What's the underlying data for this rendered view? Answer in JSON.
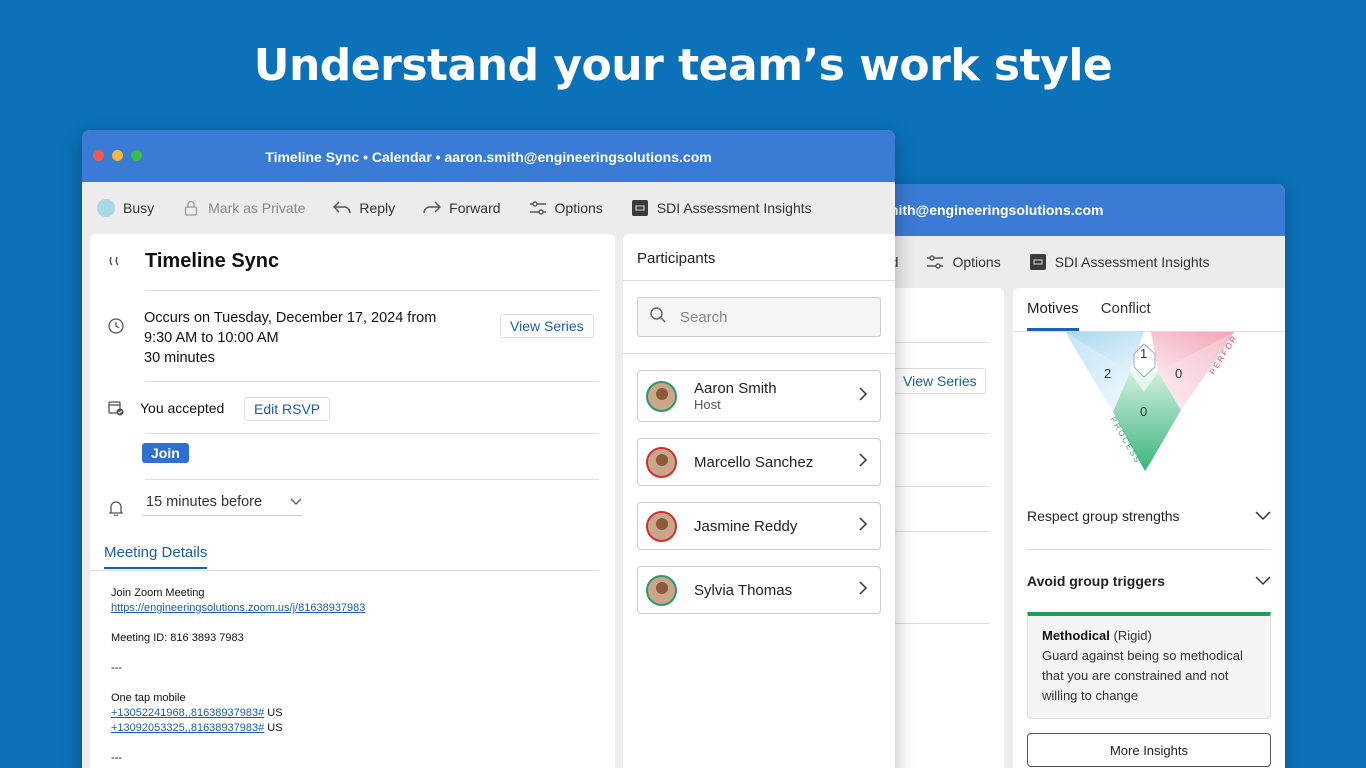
{
  "hero": "Understand your team’s work style",
  "colors": {
    "background": "#0b72b9",
    "titlebar": "#3a7bd5",
    "accent": "#1a5dab",
    "insight_border": "#1aa05a"
  },
  "back_window": {
    "title": "mith@engineeringsolutions.com",
    "toolbar": {
      "options": "Options",
      "sdi": "SDI Assessment Insights",
      "partial": "rd"
    },
    "view_series": "View Series",
    "tabs": [
      "Motives",
      "Conflict"
    ],
    "triangle": {
      "top": "1",
      "left": "2",
      "right": "0",
      "center": "0",
      "label_right": "PERFOR",
      "label_left": "PROCESS"
    },
    "respect": "Respect group strengths",
    "avoid": "Avoid group triggers",
    "insight": {
      "title": "Methodical",
      "qualifier": "(Rigid)",
      "text": "Guard against being so methodical that you are constrained and not willing to change"
    },
    "more": "More Insights"
  },
  "front_window": {
    "title": "Timeline Sync  •  Calendar  •  aaron.smith@engineeringsolutions.com",
    "toolbar": {
      "busy": "Busy",
      "private": "Mark as Private",
      "reply": "Reply",
      "forward": "Forward",
      "options": "Options",
      "sdi": "SDI Assessment Insights"
    },
    "subject": "Timeline Sync",
    "occurs_line1": "Occurs on Tuesday, December 17, 2024 from",
    "occurs_line2": "9:30 AM to 10:00 AM",
    "occurs_line3": "30 minutes",
    "view_series": "View Series",
    "accepted": "You accepted",
    "edit_rsvp": "Edit RSVP",
    "join": "Join",
    "reminder": "15 minutes before",
    "meeting_details_tab": "Meeting Details",
    "details": {
      "join_zoom": "Join Zoom Meeting",
      "zoom_link": "https://engineeringsolutions.zoom.us/j/81638937983",
      "meeting_id": "Meeting ID: 816 3893 7983",
      "dash1": "---",
      "one_tap": "One tap mobile",
      "phone1": "+13052241968,,81638937983#",
      "phone1_suffix": " US",
      "phone2": "+13092053325,,81638937983#",
      "phone2_suffix": " US",
      "dash2": "---"
    },
    "participants": {
      "title": "Participants",
      "search_placeholder": "Search",
      "people": [
        {
          "name": "Aaron Smith",
          "role": "Host"
        },
        {
          "name": "Marcello Sanchez",
          "role": ""
        },
        {
          "name": "Jasmine Reddy",
          "role": ""
        },
        {
          "name": "Sylvia Thomas",
          "role": ""
        }
      ]
    }
  }
}
